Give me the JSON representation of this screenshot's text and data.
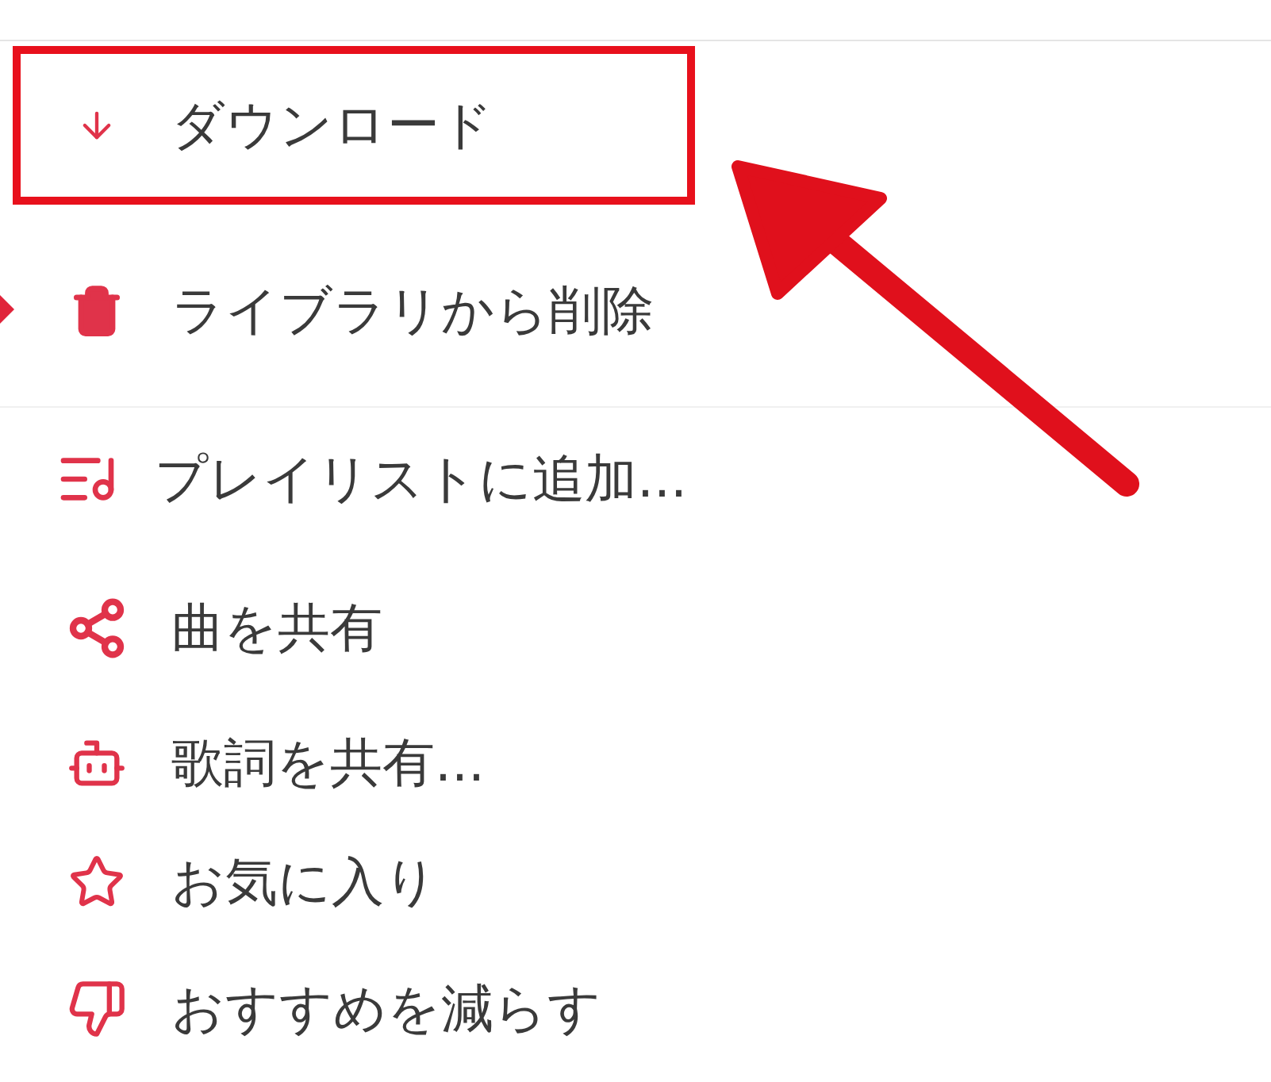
{
  "menu": {
    "items": [
      {
        "label": "ダウンロード",
        "highlighted": true
      },
      {
        "label": "ライブラリから削除",
        "highlighted": false
      },
      {
        "label": "プレイリストに追加...",
        "highlighted": false
      },
      {
        "label": "曲を共有",
        "highlighted": false
      },
      {
        "label": "歌詞を共有...",
        "highlighted": false
      },
      {
        "label": "お気に入り",
        "highlighted": false
      },
      {
        "label": "おすすめを減らす",
        "highlighted": false
      }
    ]
  }
}
